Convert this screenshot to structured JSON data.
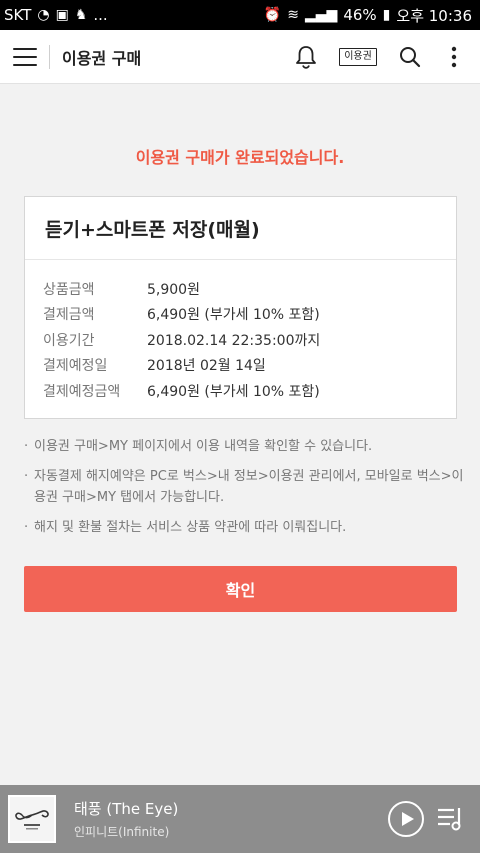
{
  "status": {
    "carrier": "SKT",
    "notifications_more": "...",
    "battery": "46%",
    "time": "오후 10:36"
  },
  "header": {
    "title": "이용권 구매",
    "ticket_label": "이용권"
  },
  "main": {
    "complete_message": "이용권 구매가 완료되었습니다.",
    "product": {
      "name": "듣기+스마트폰 저장(매월)",
      "rows": [
        {
          "label": "상품금액",
          "value": "5,900원"
        },
        {
          "label": "결제금액",
          "value": "6,490원 (부가세 10% 포함)"
        },
        {
          "label": "이용기간",
          "value": "2018.02.14 22:35:00까지"
        },
        {
          "label": "결제예정일",
          "value": "2018년 02월 14일"
        },
        {
          "label": "결제예정금액",
          "value": "6,490원 (부가세 10% 포함)"
        }
      ]
    },
    "notes": [
      "이용권 구매>MY 페이지에서 이용 내역을 확인할 수 있습니다.",
      "자동결제 해지예약은 PC로 벅스>내 정보>이용권 관리에서, 모바일로 벅스>이용권 구매>MY 탭에서 가능합니다.",
      "해지 및 환불 절차는 서비스 상품 약관에 따라 이뤄집니다."
    ],
    "confirm_label": "확인"
  },
  "player": {
    "title": "태풍 (The Eye)",
    "artist": "인피니트(Infinite)"
  },
  "colors": {
    "accent": "#ef5a45",
    "confirm_bg": "#f26456",
    "player_bg": "#8d8d8d"
  }
}
